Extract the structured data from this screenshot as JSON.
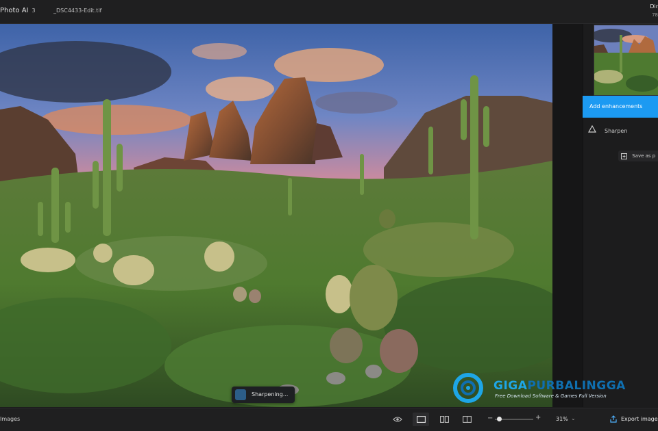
{
  "topbar": {
    "app_name": "Photo AI",
    "image_count": "3",
    "file_name": "_DSC4433-Edit.tif",
    "right_title": "Dir",
    "right_subtitle": "78"
  },
  "right_panel": {
    "primary_button": "Add enhancements",
    "enhancement_item": "Sharpen",
    "save_button": "Save as p"
  },
  "toast": {
    "label": "Sharpening..."
  },
  "watermark": {
    "title_a": "GIGA",
    "title_b": "PURBALINGGA",
    "subtitle": "Free Download Software & Games Full Version"
  },
  "bottombar": {
    "images_label": "Images",
    "zoom_value": "31%",
    "zoom_level": 0.05,
    "export_label": "Export image"
  },
  "icons": {
    "preview": "eye-icon",
    "single_view": "single-view-icon",
    "split_view": "side-by-side-icon",
    "compare_view": "split-compare-icon",
    "export": "export-icon",
    "sharpen": "triangle-icon"
  },
  "colors": {
    "accent": "#1c9af2",
    "panel": "#1c1c1d",
    "bar": "#1f1f20"
  }
}
